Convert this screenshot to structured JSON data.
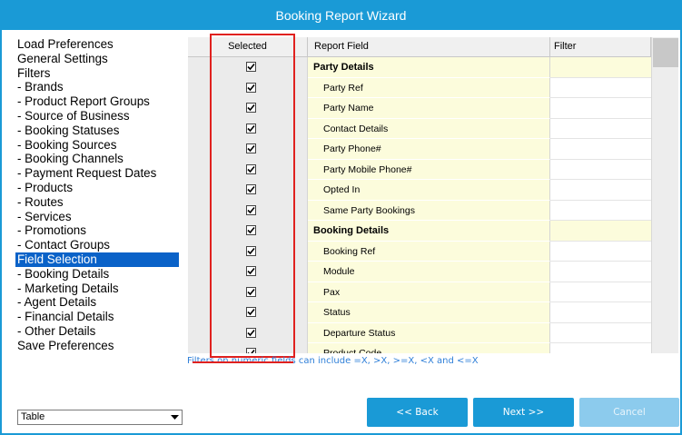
{
  "window": {
    "title": "Booking Report Wizard"
  },
  "nav": {
    "items": [
      {
        "label": "Load Preferences",
        "selected": false
      },
      {
        "label": "General Settings",
        "selected": false
      },
      {
        "label": "Filters",
        "selected": false
      },
      {
        "label": " - Brands",
        "selected": false
      },
      {
        "label": " - Product Report Groups",
        "selected": false
      },
      {
        "label": " - Source of Business",
        "selected": false
      },
      {
        "label": " - Booking Statuses",
        "selected": false
      },
      {
        "label": " - Booking Sources",
        "selected": false
      },
      {
        "label": " - Booking Channels",
        "selected": false
      },
      {
        "label": " - Payment Request Dates",
        "selected": false
      },
      {
        "label": " - Products",
        "selected": false
      },
      {
        "label": " - Routes",
        "selected": false
      },
      {
        "label": " - Services",
        "selected": false
      },
      {
        "label": " - Promotions",
        "selected": false
      },
      {
        "label": " - Contact Groups",
        "selected": false
      },
      {
        "label": "Field Selection",
        "selected": true
      },
      {
        "label": " - Booking Details",
        "selected": false
      },
      {
        "label": " - Marketing Details",
        "selected": false
      },
      {
        "label": " - Agent Details",
        "selected": false
      },
      {
        "label": " - Financial Details",
        "selected": false
      },
      {
        "label": " - Other Details",
        "selected": false
      },
      {
        "label": "Save Preferences",
        "selected": false
      }
    ]
  },
  "grid": {
    "headers": {
      "selected": "Selected",
      "field": "Report Field",
      "filter": "Filter"
    },
    "rows": [
      {
        "field": "Party Details",
        "group": true,
        "checked": true
      },
      {
        "field": "Party Ref",
        "group": false,
        "checked": true
      },
      {
        "field": "Party Name",
        "group": false,
        "checked": true
      },
      {
        "field": "Contact Details",
        "group": false,
        "checked": true
      },
      {
        "field": "Party Phone#",
        "group": false,
        "checked": true
      },
      {
        "field": "Party Mobile Phone#",
        "group": false,
        "checked": true
      },
      {
        "field": "Opted In",
        "group": false,
        "checked": true
      },
      {
        "field": "Same Party Bookings",
        "group": false,
        "checked": true
      },
      {
        "field": "Booking Details",
        "group": true,
        "checked": true
      },
      {
        "field": "Booking Ref",
        "group": false,
        "checked": true
      },
      {
        "field": "Module",
        "group": false,
        "checked": true
      },
      {
        "field": "Pax",
        "group": false,
        "checked": true
      },
      {
        "field": "Status",
        "group": false,
        "checked": true
      },
      {
        "field": "Departure Status",
        "group": false,
        "checked": true
      },
      {
        "field": "Product Code",
        "group": false,
        "checked": true
      }
    ]
  },
  "hint": "Filters on numeric fields can include =X, >X, >=X, <X and <=X",
  "footer": {
    "output_select": "Table",
    "back_label": "<< Back",
    "next_label": "Next >>",
    "cancel_label": "Cancel"
  },
  "colors": {
    "accent": "#1a9ad6",
    "selection": "#0a62c8",
    "highlight": "#e0211f",
    "field_bg": "#fcfcdc"
  }
}
